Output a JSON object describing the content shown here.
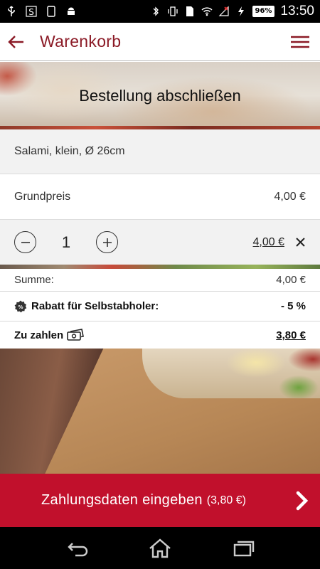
{
  "status_bar": {
    "battery": "96%",
    "time": "13:50",
    "icons": [
      "usb-icon",
      "s-app-icon",
      "phone-icon",
      "android-icon",
      "bluetooth-icon",
      "vibrate-icon",
      "sim-icon",
      "wifi-icon",
      "no-signal-icon",
      "charging-icon"
    ]
  },
  "appbar": {
    "title": "Warenkorb",
    "accent": "#8b1a26"
  },
  "hero": {
    "title": "Bestellung abschließen"
  },
  "cart": {
    "product": "Salami, klein, Ø 26cm",
    "base_price_label": "Grundpreis",
    "base_price": "4,00 €",
    "quantity": "1",
    "line_price": "4,00 €"
  },
  "summary": {
    "sum_label": "Summe:",
    "sum_value": "4,00 €",
    "discount_label": "Rabatt für Selbstabholer:",
    "discount_value": "- 5 %",
    "pay_label": "Zu zahlen",
    "pay_value": "3,80 €"
  },
  "cta": {
    "label": "Zahlungsdaten eingeben",
    "amount": "(3,80 €)",
    "color": "#c1102c"
  },
  "nav": {
    "icons": [
      "back-icon",
      "home-icon",
      "recent-apps-icon"
    ]
  }
}
